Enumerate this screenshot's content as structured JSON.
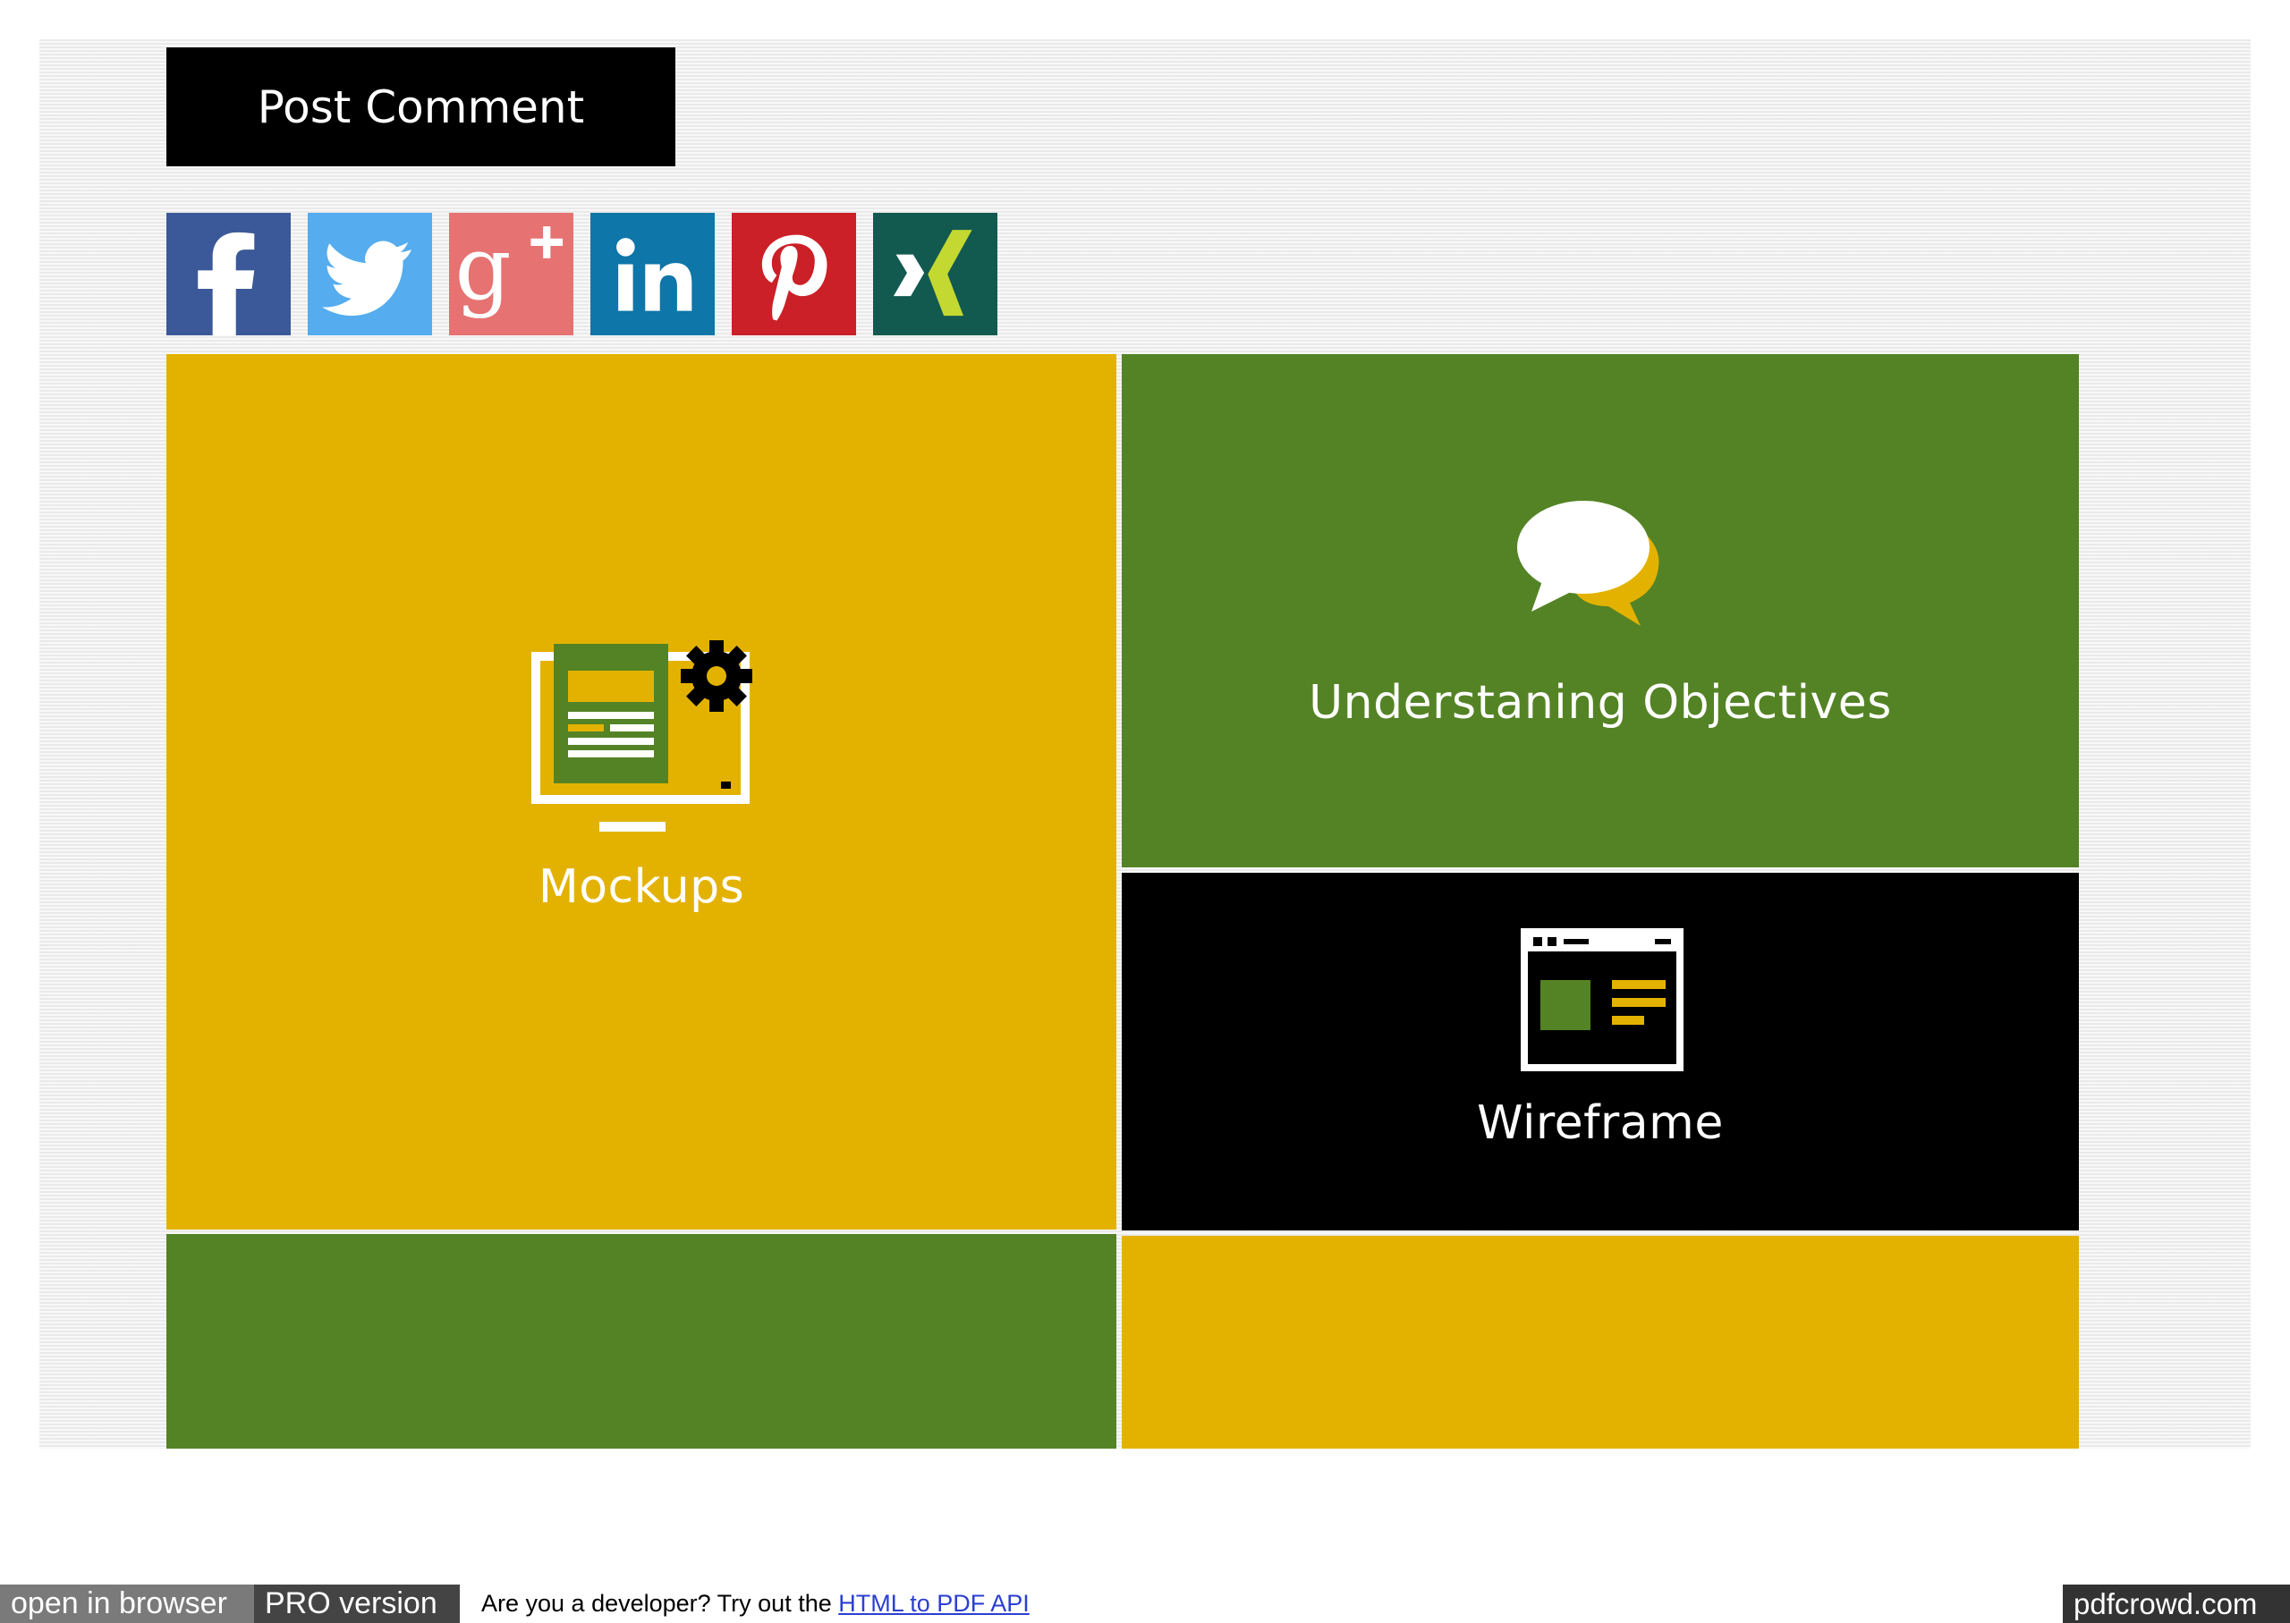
{
  "comment_form": {
    "submit_label": "Post Comment"
  },
  "share": {
    "items": [
      {
        "network": "facebook",
        "icon": "facebook-icon",
        "color": "#3b5998"
      },
      {
        "network": "twitter",
        "icon": "twitter-icon",
        "color": "#55acee"
      },
      {
        "network": "google-plus",
        "icon": "google-plus-icon",
        "color": "#e67272"
      },
      {
        "network": "linkedin",
        "icon": "linkedin-icon",
        "color": "#0e76a8"
      },
      {
        "network": "pinterest",
        "icon": "pinterest-icon",
        "color": "#cb2027"
      },
      {
        "network": "xing",
        "icon": "xing-icon",
        "color": "#125a50"
      }
    ]
  },
  "tiles": {
    "mockups": {
      "label": "Mockups",
      "color": "#e3b200",
      "icon": "monitor-gear-icon"
    },
    "objectives": {
      "label": "Understaning Objectives",
      "color": "#548325",
      "icon": "speech-bubbles-icon"
    },
    "wireframe": {
      "label": "Wireframe",
      "color": "#000000",
      "icon": "browser-window-icon"
    },
    "bottom_left": {
      "color": "#548325"
    },
    "bottom_right": {
      "color": "#e3b200"
    }
  },
  "footer": {
    "open_in_browser": "open in browser",
    "pro_version": "PRO version",
    "developer_text": "Are you a developer? Try out the ",
    "api_link": "HTML to PDF API",
    "brand": "pdfcrowd.com"
  }
}
